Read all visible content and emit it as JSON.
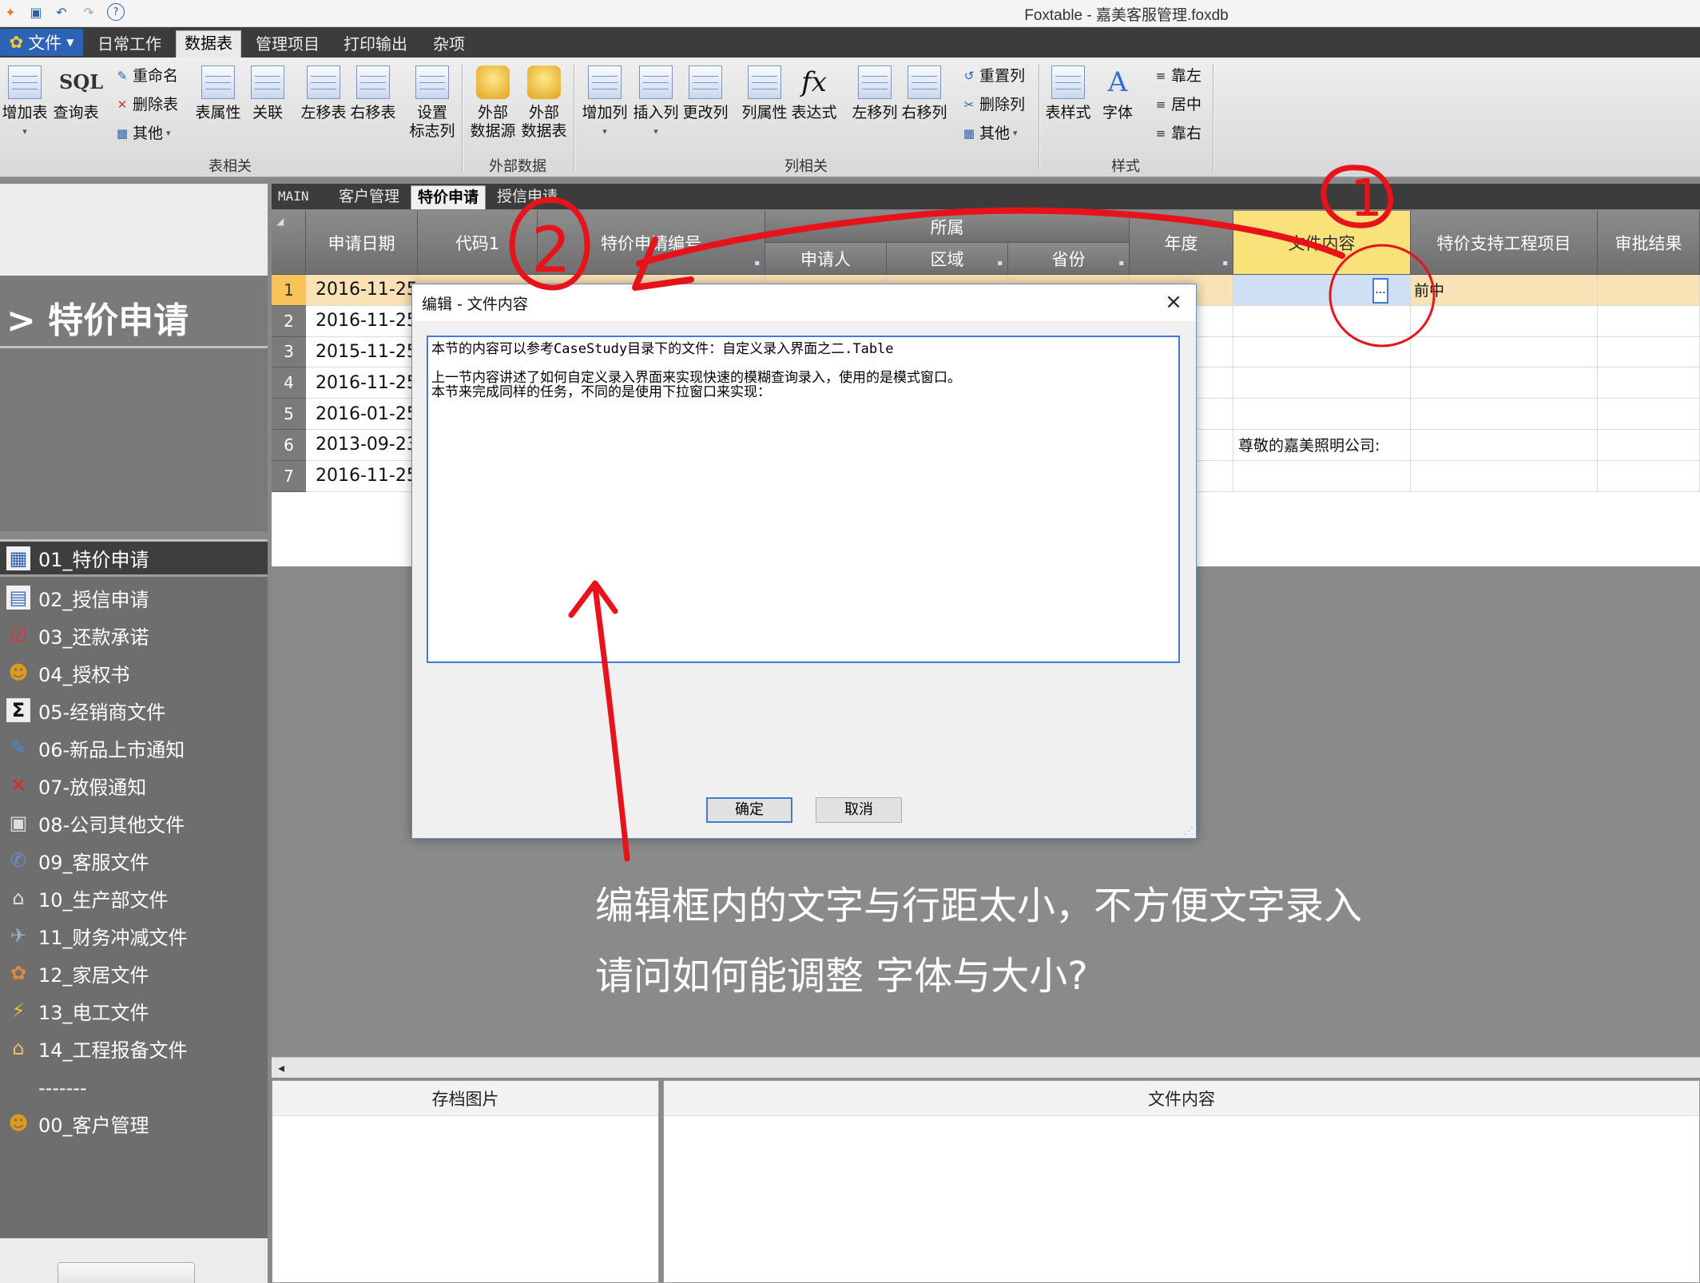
{
  "window": {
    "title": "Foxtable - 嘉美客服管理.foxdb"
  },
  "quick_access": [
    "app-icon",
    "save-icon",
    "undo-icon",
    "redo-icon",
    "help-icon"
  ],
  "menu": {
    "file_label": "文件",
    "tabs": [
      "日常工作",
      "数据表",
      "管理项目",
      "打印输出",
      "杂项"
    ],
    "active_tab": "数据表"
  },
  "ribbon": {
    "groups": {
      "table": "表相关",
      "external": "外部数据",
      "column": "列相关",
      "style": "样式"
    },
    "add_table": "增加表",
    "query_table": "查询表",
    "sql_text": "SQL",
    "rename": "重命名",
    "delete_table": "删除表",
    "other1": "其他",
    "table_props": "表属性",
    "relation": "关联",
    "move_table_left": "左移表",
    "move_table_right": "右移表",
    "set_flag_col_1": "设置",
    "set_flag_col_2": "标志列",
    "ext_source_1": "外部",
    "ext_source_2": "数据源",
    "ext_table_1": "外部",
    "ext_table_2": "数据表",
    "add_col": "增加列",
    "insert_col": "插入列",
    "change_col": "更改列",
    "col_props": "列属性",
    "expression": "表达式",
    "move_col_left": "左移列",
    "move_col_right": "右移列",
    "reset_col": "重置列",
    "delete_col": "删除列",
    "other2": "其他",
    "table_style": "表样式",
    "font": "字体",
    "align_left": "靠左",
    "align_center": "居中",
    "align_right": "靠右"
  },
  "left_panel": {
    "heading": "> 特价申请",
    "nav_items": [
      {
        "label": "01_特价申请",
        "icon": "calendar-icon"
      },
      {
        "label": "02_授信申请",
        "icon": "contact-card-icon"
      },
      {
        "label": "03_还款承诺",
        "icon": "checklist-icon"
      },
      {
        "label": "04_授权书",
        "icon": "users-icon"
      },
      {
        "label": "05-经销商文件",
        "icon": "sigma-icon"
      },
      {
        "label": "06-新品上市通知",
        "icon": "edit-icon"
      },
      {
        "label": "07-放假通知",
        "icon": "cross-icon"
      },
      {
        "label": "08-公司其他文件",
        "icon": "printer-icon"
      },
      {
        "label": "09_客服文件",
        "icon": "support-icon"
      },
      {
        "label": "10_生产部文件",
        "icon": "factory-icon"
      },
      {
        "label": "11_财务冲减文件",
        "icon": "finance-icon"
      },
      {
        "label": "12_家居文件",
        "icon": "home-items-icon"
      },
      {
        "label": "13_电工文件",
        "icon": "lightning-icon"
      },
      {
        "label": "14_工程报备文件",
        "icon": "house-icon"
      },
      {
        "label": "-------",
        "icon": ""
      },
      {
        "label": "00_客户管理",
        "icon": "users-icon"
      }
    ]
  },
  "doc_tabs": [
    "MAIN",
    "客户管理",
    "特价申请",
    "授信申请"
  ],
  "grid": {
    "headers": {
      "date": "申请日期",
      "code": "代码1",
      "req_no": "特价申请编号",
      "group": "所属",
      "applicant": "申请人",
      "region": "区域",
      "province": "省份",
      "year": "年度",
      "file_content": "文件内容",
      "project": "特价支持工程项目",
      "approval": "审批结果"
    },
    "rows": [
      {
        "n": "1",
        "date": "2016-11-25",
        "file_content": "",
        "project": "前中"
      },
      {
        "n": "2",
        "date": "2016-11-25",
        "file_content": "",
        "project": ""
      },
      {
        "n": "3",
        "date": "2015-11-25",
        "file_content": "",
        "project": ""
      },
      {
        "n": "4",
        "date": "2016-11-25",
        "file_content": "",
        "project": ""
      },
      {
        "n": "5",
        "date": "2016-01-25",
        "file_content": "",
        "project": ""
      },
      {
        "n": "6",
        "date": "2013-09-23",
        "file_content": "尊敬的嘉美照明公司:",
        "project": ""
      },
      {
        "n": "7",
        "date": "2016-11-25",
        "file_content": "",
        "project": ""
      }
    ],
    "ellipsis": "..."
  },
  "bottom_panels": {
    "image_title": "存档图片",
    "content_title": "文件内容"
  },
  "dialog": {
    "title": "编辑 - 文件内容",
    "close": "×",
    "lines": [
      "本节的内容可以参考CaseStudy目录下的文件：自定义录入界面之二.Table",
      "",
      "上一节内容讲述了如何自定义录入界面来实现快速的模糊查询录入，使用的是模式窗口。",
      "本节来完成同样的任务，不同的是使用下拉窗口来实现："
    ],
    "ok": "确定",
    "cancel": "取消"
  },
  "annotation": {
    "line1": "编辑框内的文字与行距太小，不方便文字录入",
    "line2": "请问如何能调整 字体与大小?",
    "marker1": "1",
    "marker2": "2",
    "ink_color": "#e8121a"
  },
  "colors": {
    "accent": "#2c63b4",
    "selected_header": "#f9e27a",
    "selected_row": "#fbe2b6",
    "dialog_border": "#3d7bd6"
  }
}
